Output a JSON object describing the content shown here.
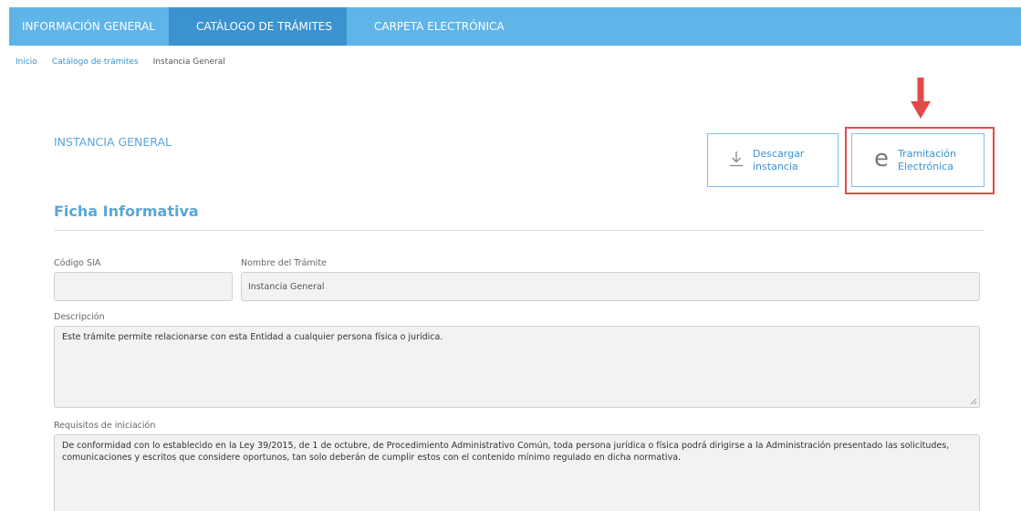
{
  "nav": {
    "tabs": [
      {
        "label": "INFORMACIÓN GENERAL",
        "active": false
      },
      {
        "label": "CATÁLOGO DE TRÁMITES",
        "active": true
      },
      {
        "label": "CARPETA ELECTRÓNICA",
        "active": false
      }
    ]
  },
  "breadcrumb": {
    "items": [
      "Inicio",
      "Catálogo de trámites",
      "Instancia General"
    ]
  },
  "page": {
    "title": "INSTANCIA GENERAL",
    "subheading": "Ficha Informativa"
  },
  "actions": {
    "download_label": "Descargar\ninstancia",
    "electronic_label": "Tramitación\nElectrónica",
    "download_icon": "download-icon",
    "electronic_icon": "e-icon"
  },
  "form": {
    "sia_code_label": "Código SIA",
    "sia_code_value": "",
    "procedure_name_label": "Nombre del Trámite",
    "procedure_name_value": "Instancia General",
    "description_label": "Descripción",
    "description_value": "Este trámite permite relacionarse con esta Entidad a cualquier persona física o jurídica.",
    "requirements_label": "Requisitos de iniciación",
    "requirements_value": "De conformidad con lo establecido en la Ley 39/2015, de 1 de octubre, de Procedimiento Administrativo Común, toda persona jurídica o física podrá dirigirse a la Administración presentado las solicitudes, comunicaciones y escritos que considere oportunos, tan solo deberán de cumplir estos con el contenido mínimo regulado en dicha normativa."
  },
  "colors": {
    "nav_bg": "#5fb4e8",
    "nav_active": "#3a93cf",
    "accent": "#5aa6d8",
    "annotation": "#e24a4a"
  }
}
